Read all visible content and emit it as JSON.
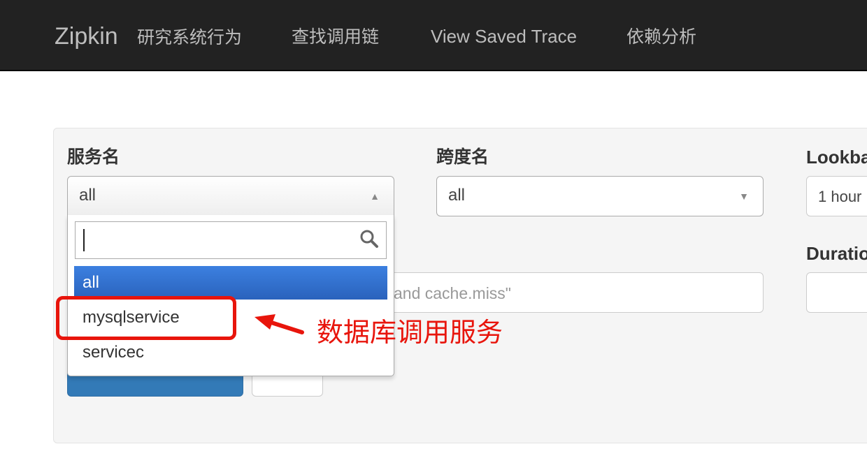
{
  "navbar": {
    "brand": "Zipkin",
    "brand_subtitle": "研究系统行为",
    "links": [
      "查找调用链",
      "View Saved Trace",
      "依赖分析"
    ]
  },
  "form": {
    "service_label": "服务名",
    "service_value": "all",
    "span_label": "跨度名",
    "span_value": "all",
    "lookback_label": "Lookba",
    "lookback_value": "1 hour",
    "duration_label": "Duratio",
    "annotations_placeholder_visible": "and cache.miss\""
  },
  "dropdown": {
    "search_value": "",
    "options": [
      "all",
      "mysqlservice",
      "servicec"
    ],
    "highlighted": "all"
  },
  "annotation": {
    "text": "数据库调用服务",
    "color": "#e8150c"
  },
  "colors": {
    "navbar_bg": "#222222",
    "panel_bg": "#f5f5f5",
    "primary_button": "#337ab7",
    "highlight": "#3875d7"
  }
}
